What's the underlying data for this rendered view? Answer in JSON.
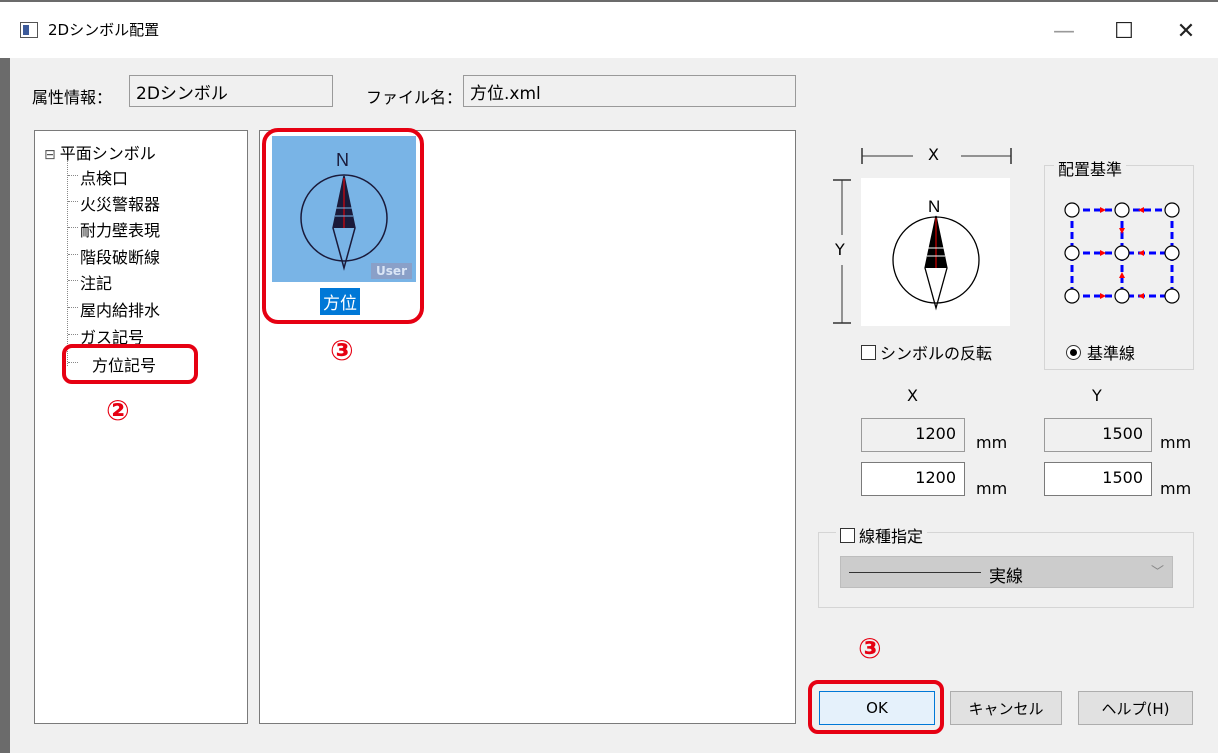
{
  "window": {
    "title": "2Dシンボル配置",
    "minimize_glyph": "—",
    "maximize_glyph": "☐",
    "close_glyph": "✕"
  },
  "header": {
    "attribute_label": "属性情報：",
    "attribute_value": "2Dシンボル",
    "filename_label": "ファイル名：",
    "filename_value": "方位.xml"
  },
  "tree": {
    "root": "平面シンボル",
    "root_toggle": "⊟",
    "items": [
      "点検口",
      "火災警報器",
      "耐力壁表現",
      "階段破断線",
      "注記",
      "屋内給排水",
      "ガス記号",
      "方位記号"
    ],
    "selected_index": 7
  },
  "gallery": {
    "items": [
      {
        "label": "方位",
        "tag": "User",
        "selected": true,
        "north": "N"
      }
    ]
  },
  "annotations": {
    "step2": "②",
    "step3_symbol": "③",
    "step3_ok": "③",
    "color": "#e60012"
  },
  "preview": {
    "x_label": "X",
    "y_label": "Y",
    "north": "N",
    "flip_label": "シンボルの反転",
    "flip_checked": false
  },
  "placement": {
    "title": "配置基準",
    "option_label": "基準線",
    "option_selected": true
  },
  "size": {
    "x_header": "X",
    "y_header": "Y",
    "x_orig": "1200",
    "y_orig": "1500",
    "x_value": "1200",
    "y_value": "1500",
    "unit": "mm"
  },
  "linetype": {
    "label": "線種指定",
    "checked": false,
    "selected": "実線",
    "dropdown_icon": "﹀"
  },
  "buttons": {
    "ok": "OK",
    "cancel": "キャンセル",
    "help": "ヘルプ(H)"
  },
  "colors": {
    "thumb_bg": "#79b4e6",
    "selection": "#0078d7",
    "highlight": "#e60012",
    "grid_blue": "#0000ff",
    "arrow_red": "#ff0000"
  }
}
